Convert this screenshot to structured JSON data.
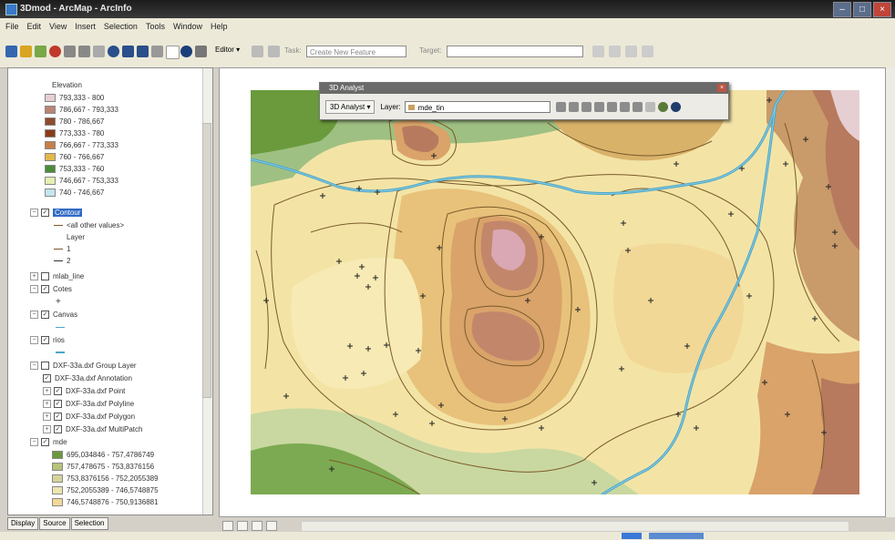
{
  "window": {
    "title": "3Dmod - ArcMap - ArcInfo"
  },
  "menu": [
    "File",
    "Edit",
    "View",
    "Insert",
    "Selection",
    "Tools",
    "Window",
    "Help"
  ],
  "toolbar": {
    "editor_label": "Editor ▾",
    "task_label": "Task:",
    "task_value": "Create New Feature",
    "target_label": "Target:"
  },
  "toc": {
    "elevation_header": "Elevation",
    "elevation_classes": [
      {
        "label": "793,333 - 800",
        "color": "#e6cfd2"
      },
      {
        "label": "786,667 - 793,333",
        "color": "#b98674"
      },
      {
        "label": "780 - 786,667",
        "color": "#8e4a2c"
      },
      {
        "label": "773,333 - 780",
        "color": "#8a3b18"
      },
      {
        "label": "766,667 - 773,333",
        "color": "#c87f47"
      },
      {
        "label": "760 - 766,667",
        "color": "#e3b84a"
      },
      {
        "label": "753,333 - 760",
        "color": "#4b8d38"
      },
      {
        "label": "746,667 - 753,333",
        "color": "#e8efb3"
      },
      {
        "label": "740 - 746,667",
        "color": "#c3e6ef"
      }
    ],
    "contour_layer": "Contour",
    "contour_subs": [
      "<all other values>",
      "Layer",
      "1",
      "2"
    ],
    "layers": [
      "mlab_line",
      "Cotes",
      "Canvas",
      "rios"
    ],
    "group_layer": "DXF-33a.dxf Group Layer",
    "group_items": [
      "DXF-33a.dxf Annotation",
      "DXF-33a.dxf Point",
      "DXF-33a.dxf Polyline",
      "DXF-33a.dxf Polygon",
      "DXF-33a.dxf MultiPatch"
    ],
    "mde_layer": "mde",
    "mde_classes": [
      {
        "label": "695,034846 - 757,4786749",
        "color": "#6a9a3c"
      },
      {
        "label": "757,478675 - 753,8376156",
        "color": "#b8c27a"
      },
      {
        "label": "753,8376156 - 752,2055389",
        "color": "#d4d49a"
      },
      {
        "label": "752,2055389 - 746,5748875",
        "color": "#ece6b0"
      },
      {
        "label": "746,5748876 - 750,9136881",
        "color": "#f2d896"
      }
    ],
    "tabs": [
      "Display",
      "Source",
      "Selection"
    ]
  },
  "analyst": {
    "title": "3D Analyst",
    "menu_label": "3D Analyst ▾",
    "layer_label": "Layer:",
    "layer_value": "mde_tin"
  },
  "colors": {
    "water": "#4aa6c8",
    "contour": "#7a5a2a",
    "peak": "#d9a8b4"
  }
}
